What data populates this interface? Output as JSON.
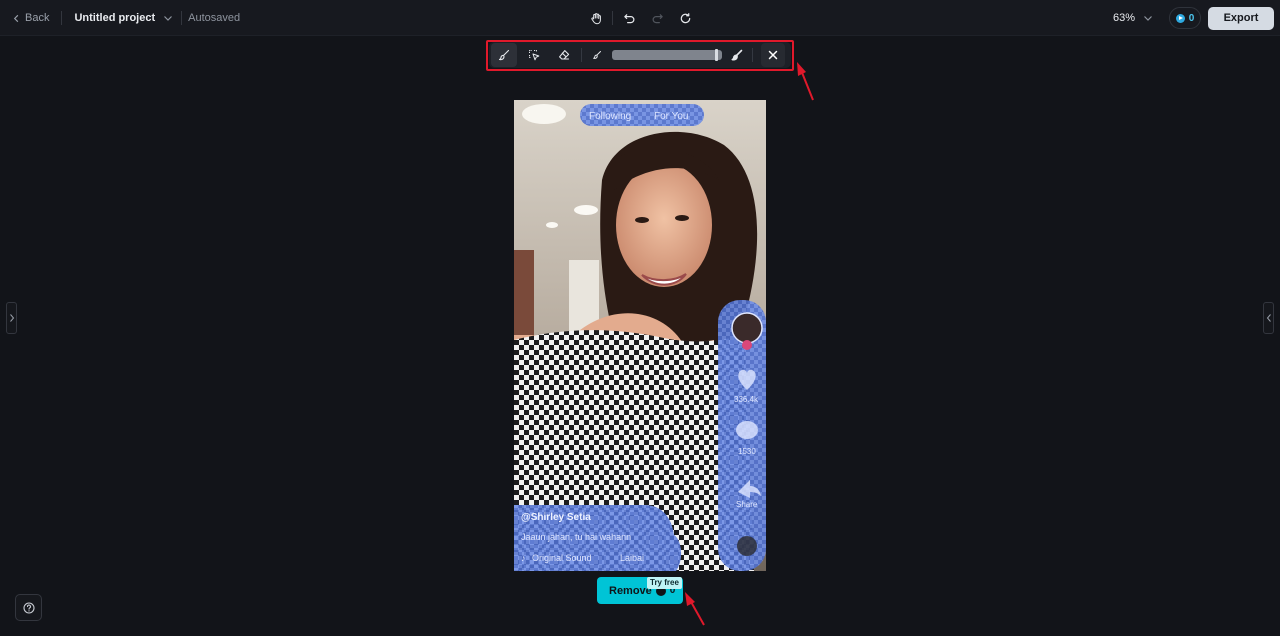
{
  "topbar": {
    "back_label": "Back",
    "project_title": "Untitled project",
    "autosave_status": "Autosaved",
    "zoom_level": "63%",
    "credits_count": "0",
    "export_label": "Export"
  },
  "brush_toolbar": {
    "tools": [
      "brush-icon",
      "select-area-icon",
      "eraser-icon",
      "brush-small-icon",
      "brush-large-icon",
      "close-icon"
    ],
    "active_tool": "brush",
    "brush_size_fraction": 0.96
  },
  "canvas": {
    "overlay_texts": {
      "tab_following": "Following",
      "tab_for_you": "For You",
      "likes": "336.4k",
      "comments": "1530",
      "share": "Share",
      "username": "@Shirley Setia",
      "caption": "Jaaun jahan, tu hai wahann",
      "sound": "Original Sound",
      "sound_artist": "Laibai"
    }
  },
  "remove_button": {
    "label": "Remove",
    "cost": "0",
    "badge": "Try free"
  },
  "colors": {
    "background": "#121419",
    "accent": "#00c4d6",
    "highlight": "#e0192b",
    "mask_overlay": "#6f8ee6"
  }
}
